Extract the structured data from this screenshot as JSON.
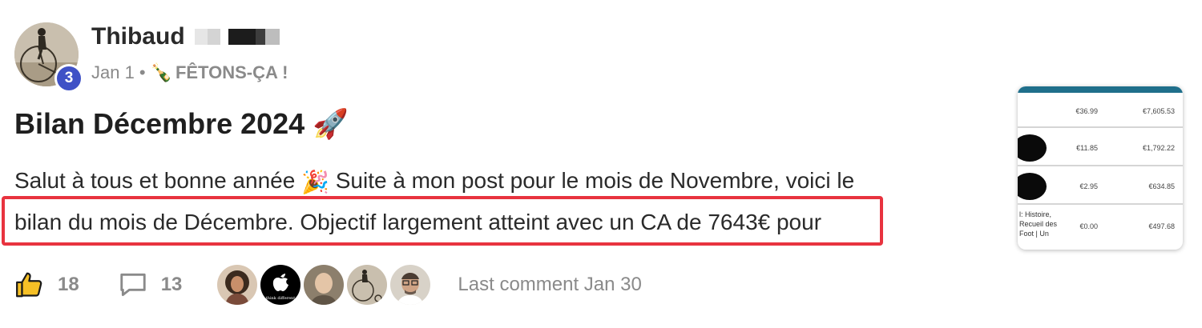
{
  "author": {
    "name": "Thibaud",
    "level": "3",
    "avatar_icon": "penny-farthing-rider-avatar"
  },
  "meta": {
    "date": "Jan 1",
    "separator": "•",
    "category_emoji": "🍾",
    "category": "FÊTONS-ÇA !"
  },
  "post": {
    "title": "Bilan Décembre 2024",
    "title_emoji": "🚀",
    "line1_a": "Salut à tous et bonne année",
    "line1_emoji": "🎉",
    "line1_b": "Suite à mon post pour le mois de Novembre, voici le",
    "line2": "bilan du mois de Décembre. Objectif largement atteint avec un CA de 7643€ pour",
    "highlight_color": "#e8333f"
  },
  "thumbnail": {
    "rows": [
      {
        "label": "",
        "v1": "€36.99",
        "v2": "€7,605.53"
      },
      {
        "label": "",
        "v1": "€11.85",
        "v2": "€1,792.22"
      },
      {
        "label": "",
        "v1": "€2.95",
        "v2": "€634.85"
      },
      {
        "label": "l: Histoire, Recueil des Foot | Un",
        "v1": "€0.00",
        "v2": "€497.68"
      }
    ]
  },
  "footer": {
    "likes": "18",
    "comments": "13",
    "last_comment": "Last comment Jan 30",
    "participants": [
      {
        "icon": "avatar-woman-curly-hair"
      },
      {
        "icon": "avatar-apple-logo",
        "caption": "think different"
      },
      {
        "icon": "avatar-bald-man"
      },
      {
        "icon": "avatar-penny-farthing"
      },
      {
        "icon": "avatar-man-glasses"
      }
    ]
  },
  "colors": {
    "badge": "#3f51c6",
    "highlight": "#e8333f",
    "thumb_bar": "#1f6f8b"
  }
}
